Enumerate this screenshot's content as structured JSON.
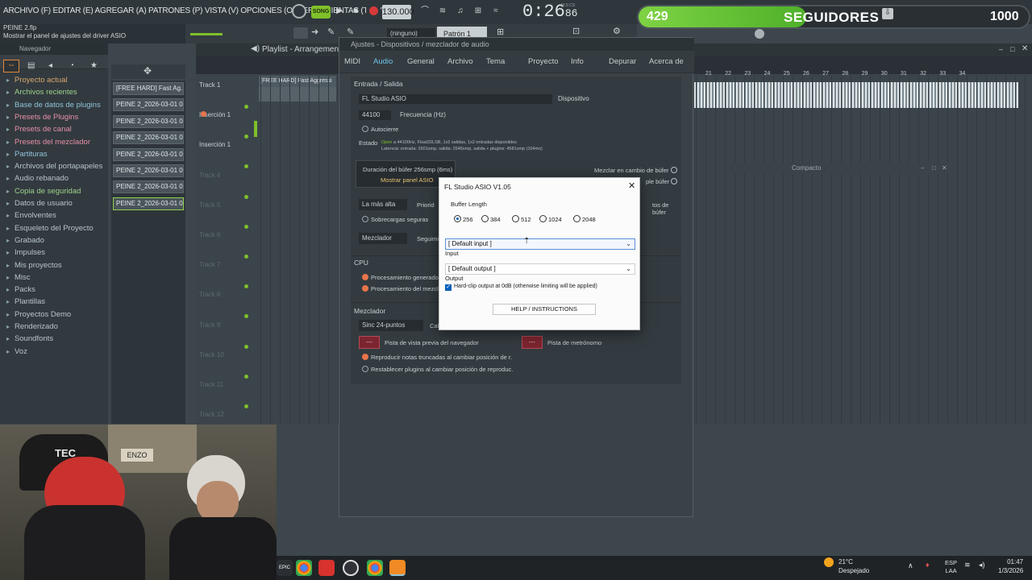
{
  "menubar": {
    "menu_text": "ARCHIVO (F) EDITAR (E) AGREGAR (A) PATRONES (P) VISTA (V) OPCIONES (O) HERRAMIENTAS (T) AYUDA",
    "song_label": "SONG",
    "tempo": "130.000",
    "clock_main": "0:26",
    "clock_frac": "86",
    "clock_label": "M:S:CS"
  },
  "infobar": {
    "file": "PEINE 2.flp",
    "hint": "Mostrar el panel de ajustes del driver ASIO"
  },
  "overlay": {
    "followers": "429",
    "label": "SEGUIDORES",
    "goal": "1000",
    "progress": 0.429
  },
  "toolbar2": {
    "pattern_none": "(ninguno)",
    "pattern": "Patrón 1"
  },
  "browser": {
    "header": "Navegador",
    "items": [
      {
        "label": "Proyecto actual",
        "color": "#d9a86a"
      },
      {
        "label": "Archivos recientes",
        "color": "#9fd18a"
      },
      {
        "label": "Base de datos de plugins",
        "color": "#8fc3d9"
      },
      {
        "label": "Presets de Plugins",
        "color": "#e88fa8"
      },
      {
        "label": "Presets de canal",
        "color": "#e88fa8"
      },
      {
        "label": "Presets del mezclador",
        "color": "#e88fa8"
      },
      {
        "label": "Partituras",
        "color": "#8fc3d9"
      },
      {
        "label": "Archivos del portapapeles",
        "color": "#b7c4c9"
      },
      {
        "label": "Audio rebanado",
        "color": "#b7c4c9"
      },
      {
        "label": "Copia de seguridad",
        "color": "#9fd18a"
      },
      {
        "label": "Datos de usuario",
        "color": "#b7c4c9"
      },
      {
        "label": "Envolventes",
        "color": "#b7c4c9"
      },
      {
        "label": "Esqueleto del Proyecto",
        "color": "#b7c4c9"
      },
      {
        "label": "Grabado",
        "color": "#b7c4c9"
      },
      {
        "label": "Impulses",
        "color": "#b7c4c9"
      },
      {
        "label": "Mis proyectos",
        "color": "#b7c4c9"
      },
      {
        "label": "Misc",
        "color": "#b7c4c9"
      },
      {
        "label": "Packs",
        "color": "#b7c4c9"
      },
      {
        "label": "Plantillas",
        "color": "#b7c4c9"
      },
      {
        "label": "Proyectos Demo",
        "color": "#b7c4c9"
      },
      {
        "label": "Renderizado",
        "color": "#b7c4c9"
      },
      {
        "label": "Soundfonts",
        "color": "#b7c4c9"
      },
      {
        "label": "Voz",
        "color": "#b7c4c9"
      }
    ]
  },
  "picker": {
    "items": [
      "[FREE HARD] Fast Ag…",
      "PEINE 2_2026-03-01 01-…",
      "PEINE 2_2026-03-01 01-…",
      "PEINE 2_2026-03-01 01-…",
      "PEINE 2_2026-03-01 01-…",
      "PEINE 2_2026-03-01 01-…",
      "PEINE 2_2026-03-01 01-…",
      "PEINE 2_2026-03-01 01-…"
    ]
  },
  "playlist": {
    "title": "Playlist - Arrangement",
    "clip_label": "[FREE HARD] Fast Aggressi",
    "tracks": [
      "Track 1",
      "Inserción 1",
      "Inserción 1",
      "Track 4",
      "Track 5",
      "Track 6",
      "Track 7",
      "Track 8",
      "Track 9",
      "Track 10",
      "Track 11",
      "Track 12"
    ],
    "bar_numbers": [
      "21",
      "22",
      "23",
      "24",
      "25",
      "26",
      "27",
      "28",
      "29",
      "30",
      "31",
      "32",
      "33",
      "34"
    ],
    "compact_label": "Compacto"
  },
  "settings": {
    "title": "Ajustes - Dispositivos / mezclador de audio",
    "tabs": [
      "MIDI",
      "Audio",
      "General",
      "Archivo",
      "Tema",
      "Proyecto",
      "Info",
      "Depurar",
      "Acerca de"
    ],
    "io_section": "Entrada / Salida",
    "device_value": "FL Studio ASIO",
    "device_label": "Dispositivo",
    "freq_value": "44100",
    "freq_label": "Frecuencia (Hz)",
    "autoclose": "Autocierre",
    "status_label": "Estado",
    "status_open": "Open",
    "status_line1": "a 44100Hz, Float32LSB, 1x2 salidas, 1x2 entradas disponibles",
    "status_line2": "Latencia: entrada: 2601smp, salida: 2646smp, salida + plugins: 4581smp (104ms)",
    "buffer_duration": "Duración del búfer 256smp (6ms)",
    "show_asio": "Mostrar panel ASIO",
    "mix_buffer_change": "Mezclar en cambio de búfer",
    "triple_buffer": "ple búfer",
    "priority_value": "La más alta",
    "priority_label": "Priorid",
    "buffer_tail": "tos de búfer",
    "safe_overloads": "Sobrecargas seguras",
    "mixer_value": "Mezclador",
    "follow_label": "Seguimi",
    "cpu_section": "CPU",
    "cpu_opt1": "Procesamiento generador",
    "cpu_opt2": "Procesamiento del mezcla",
    "mixer_section": "Mezclador",
    "sync_value": "Sinc 24-puntos",
    "sync_label": "Cal",
    "browser_preview": "Pista de vista previa del navegador",
    "metronome": "Pista de metrónomo",
    "mix_opt1": "Reproducir notas truncadas al cambiar posición de r.",
    "mix_opt2": "Restablecer plugins al cambiar posición de reproduc.",
    "red_label": "---"
  },
  "asio": {
    "title": "FL Studio ASIO V1.05",
    "buffer_length_label": "Buffer Length",
    "buffer_options": [
      "256",
      "384",
      "512",
      "1024",
      "2048"
    ],
    "selected_buffer": "256",
    "input_value": "[ Default input ]",
    "input_label": "Input",
    "output_value": "[ Default output ]",
    "output_label": "Output",
    "hardclip_label": "Hard-clip output at 0dB (otherwise limiting will be applied)",
    "hardclip_checked": true,
    "help_button": "HELP / INSTRUCTIONS"
  },
  "webcam": {
    "cap_text": "TEC",
    "poster_text": "ENZO"
  },
  "taskbar": {
    "temperature": "21°C",
    "weather": "Despejado",
    "lang_top": "ESP",
    "lang_bottom": "LAA",
    "time": "01:47",
    "date": "1/3/2026"
  },
  "colors": {
    "accent_green": "#7ed343",
    "fl_blue": "#6fc2ea",
    "record_red": "#d63a3a"
  }
}
